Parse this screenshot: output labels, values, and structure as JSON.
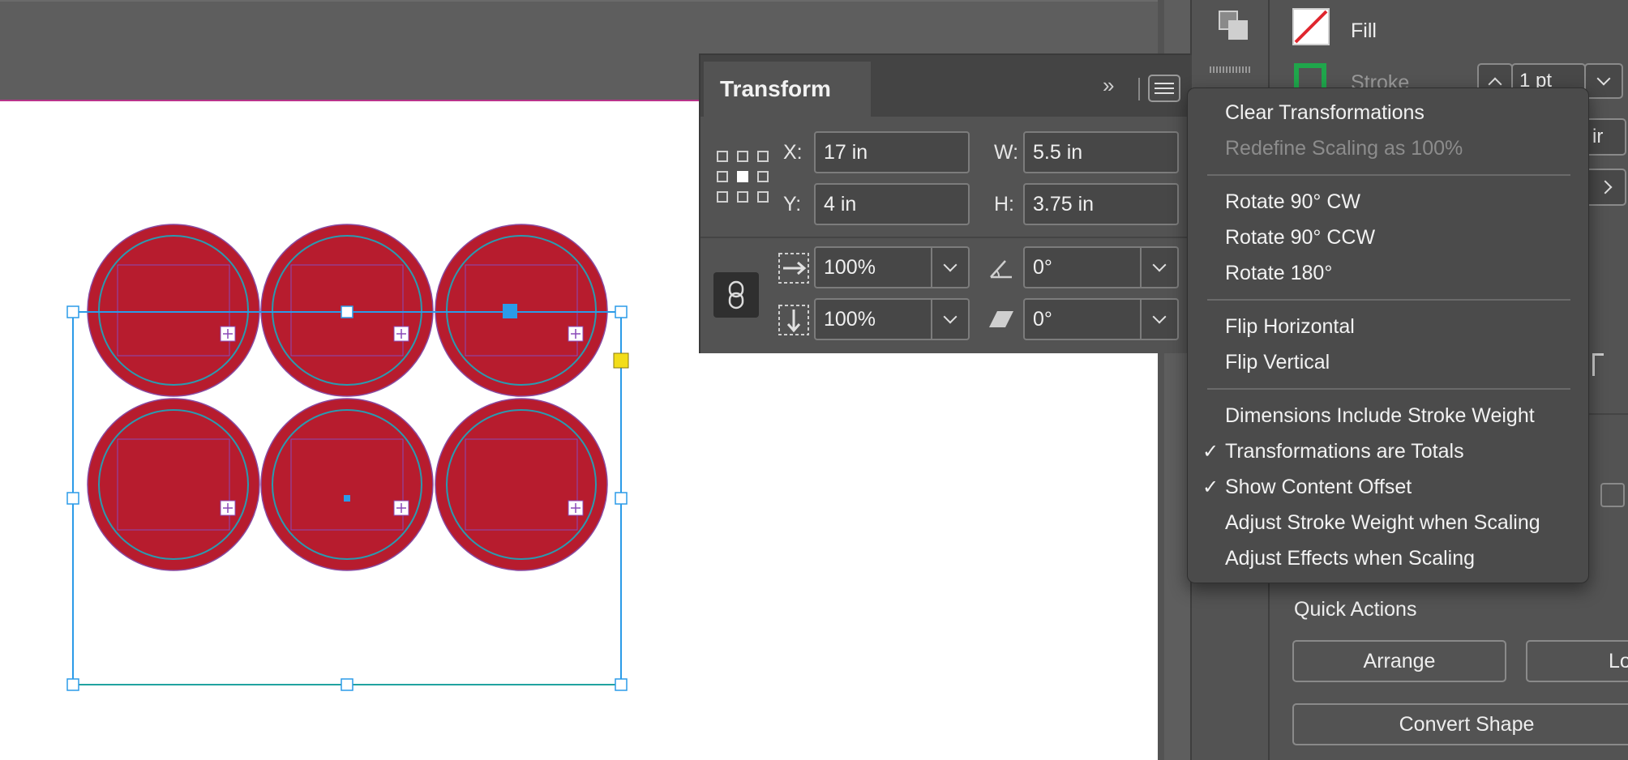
{
  "transform_panel": {
    "tab_title": "Transform",
    "x_label": "X:",
    "x_value": "17 in",
    "y_label": "Y:",
    "y_value": "4 in",
    "w_label": "W:",
    "w_value": "5.5 in",
    "h_label": "H:",
    "h_value": "3.75 in",
    "scale_x": "100%",
    "scale_y": "100%",
    "rotation": "0°",
    "shear": "0°",
    "collapse_glyph": "»",
    "reference_point_selected": "center"
  },
  "context_menu": {
    "items": [
      {
        "label": "Clear Transformations",
        "enabled": true,
        "checked": false
      },
      {
        "label": "Redefine Scaling as 100%",
        "enabled": false,
        "checked": false
      },
      {
        "label": "Rotate 90° CW",
        "enabled": true,
        "checked": false
      },
      {
        "label": "Rotate 90° CCW",
        "enabled": true,
        "checked": false
      },
      {
        "label": "Rotate 180°",
        "enabled": true,
        "checked": false
      },
      {
        "label": "Flip Horizontal",
        "enabled": true,
        "checked": false
      },
      {
        "label": "Flip Vertical",
        "enabled": true,
        "checked": false
      },
      {
        "label": "Dimensions Include Stroke Weight",
        "enabled": true,
        "checked": false
      },
      {
        "label": "Transformations are Totals",
        "enabled": true,
        "checked": true
      },
      {
        "label": "Show Content Offset",
        "enabled": true,
        "checked": true
      },
      {
        "label": "Adjust Stroke Weight when Scaling",
        "enabled": true,
        "checked": false
      },
      {
        "label": "Adjust Effects when Scaling",
        "enabled": true,
        "checked": false
      }
    ],
    "check_glyph": "✓"
  },
  "properties_panel": {
    "fill_label": "Fill",
    "stroke_label": "Stroke",
    "stroke_weight": "1 pt",
    "partial_field": "ir",
    "quick_actions_title": "Quick Actions",
    "arrange_button": "Arrange",
    "partial_button": "Lo",
    "convert_shape_button": "Convert Shape"
  },
  "artwork": {
    "circle_fill": "#b71c2e",
    "circle_stroke": "#2a9bb0",
    "selection_color": "#2b9be8",
    "out_port_color": "#f2dd1a",
    "rows": 2,
    "cols": 3
  }
}
